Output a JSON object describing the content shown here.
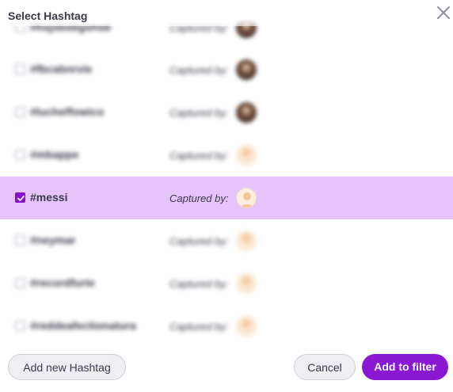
{
  "dialog": {
    "title": "Select Hashtag"
  },
  "hashtags": [
    {
      "tag": "#hsjsbsbgshsb",
      "captured_by_label": "Captured by:",
      "checked": false,
      "avatar": "dark"
    },
    {
      "tag": "#fbcabnrvie",
      "captured_by_label": "Captured by:",
      "checked": false,
      "avatar": "dark"
    },
    {
      "tag": "#lucheffowico",
      "captured_by_label": "Captured by:",
      "checked": false,
      "avatar": "dark"
    },
    {
      "tag": "#mbappe",
      "captured_by_label": "Captured by:",
      "checked": false,
      "avatar": "light"
    },
    {
      "tag": "#messi",
      "captured_by_label": "Captured by:",
      "checked": true,
      "avatar": "cream"
    },
    {
      "tag": "#neymar",
      "captured_by_label": "Captured by:",
      "checked": false,
      "avatar": "light"
    },
    {
      "tag": "#recordfurie",
      "captured_by_label": "Captured by:",
      "checked": false,
      "avatar": "light"
    },
    {
      "tag": "#reddeafectionatura",
      "captured_by_label": "Captured by:",
      "checked": false,
      "avatar": "light"
    }
  ],
  "footer": {
    "add_new_label": "Add new Hashtag",
    "cancel_label": "Cancel",
    "apply_label": "Add to filter"
  },
  "colors": {
    "accent": "#8a18d2",
    "selected_row": "#e6c4fb"
  }
}
